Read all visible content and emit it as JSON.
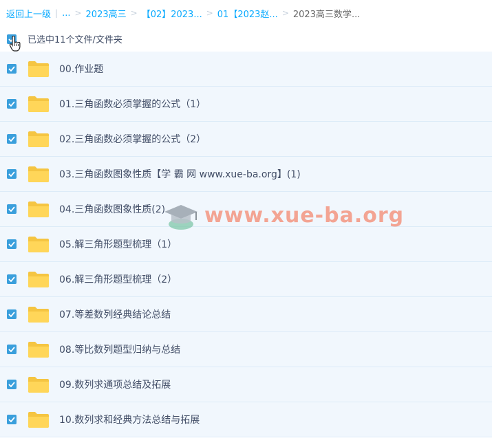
{
  "breadcrumb": {
    "back": "返回上一级",
    "items": [
      "...",
      "2023高三",
      "【02】2023...",
      "01【2023赵...",
      "2023高三数学..."
    ]
  },
  "selection": {
    "text": "已选中11个文件/文件夹"
  },
  "files": [
    "00.作业题",
    "01.三角函数必须掌握的公式（1）",
    "02.三角函数必须掌握的公式（2）",
    "03.三角函数图象性质【学 霸 网 www.xue-ba.org】(1)",
    "04.三角函数图象性质(2)",
    "05.解三角形题型梳理（1）",
    "06.解三角形题型梳理（2）",
    "07.等差数列经典结论总结",
    "08.等比数列题型归纳与总结",
    "09.数列求通项总结及拓展",
    "10.数列求和经典方法总结与拓展"
  ],
  "watermark": "www.xue-ba.org",
  "colors": {
    "link": "#09aaff",
    "checkbox": "#3a9fdc",
    "row_bg": "#f1f7fd",
    "folder": "#ffd659"
  }
}
